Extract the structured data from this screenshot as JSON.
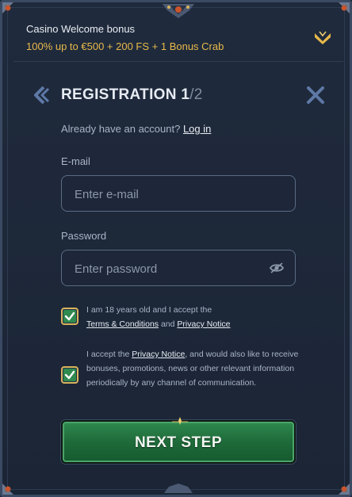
{
  "bonus": {
    "title": "Casino Welcome bonus",
    "offer": "100% up to €500 + 200 FS + 1 Bonus Crab",
    "toggle_icon": "chevron-down-icon"
  },
  "registration": {
    "title": "REGISTRATION 1",
    "step_separator_total": "/2",
    "back_icon": "chevron-left-icon",
    "close_icon": "close-icon"
  },
  "login_prompt": {
    "text": "Already have an account?",
    "link": "Log in"
  },
  "email": {
    "label": "E-mail",
    "placeholder": "Enter e-mail",
    "value": ""
  },
  "password": {
    "label": "Password",
    "placeholder": "Enter password",
    "value": "",
    "toggle_icon": "eye-icon"
  },
  "consent_age": {
    "checked": true,
    "text_before": "I am 18 years old and I accept the",
    "terms_link": "Terms & Conditions",
    "and": "and",
    "privacy_link": "Privacy Notice"
  },
  "consent_marketing": {
    "checked": true,
    "text_before": "I accept the",
    "privacy_link": "Privacy Notice",
    "text_after": ", and would also like to receive bonuses, promotions, news or other relevant information periodically by any channel of communication."
  },
  "next_button": {
    "label": "NEXT STEP"
  },
  "colors": {
    "accent_gold": "#e8b94a",
    "button_green": "#1f6b3a",
    "panel_bg": "#1f2a3c"
  }
}
